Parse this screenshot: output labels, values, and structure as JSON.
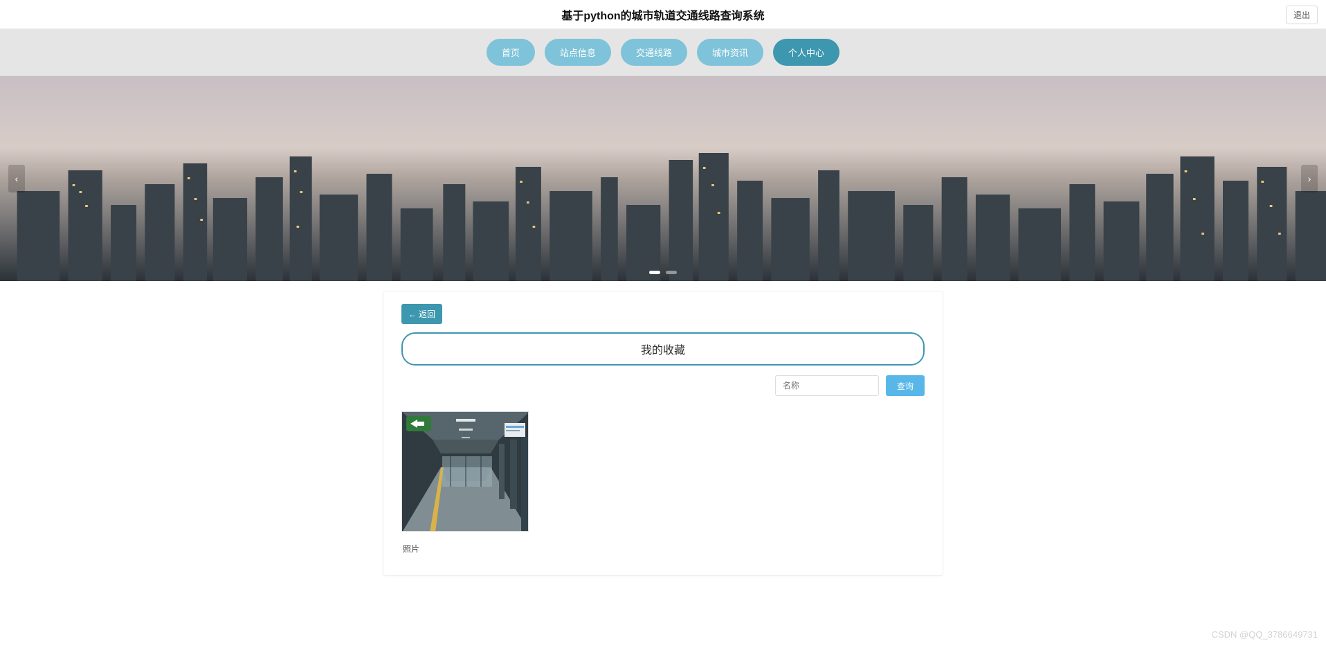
{
  "header": {
    "title": "基于python的城市轨道交通线路查询系统",
    "logout": "退出"
  },
  "nav": {
    "items": [
      {
        "label": "首页"
      },
      {
        "label": "站点信息"
      },
      {
        "label": "交通线路"
      },
      {
        "label": "城市资讯"
      },
      {
        "label": "个人中心"
      }
    ]
  },
  "panel": {
    "back_label": "返回",
    "section_title": "我的收藏",
    "search_placeholder": "名称",
    "search_btn": "查询"
  },
  "cards": [
    {
      "caption": "照片"
    }
  ],
  "watermark": "CSDN @QQ_3786649731"
}
